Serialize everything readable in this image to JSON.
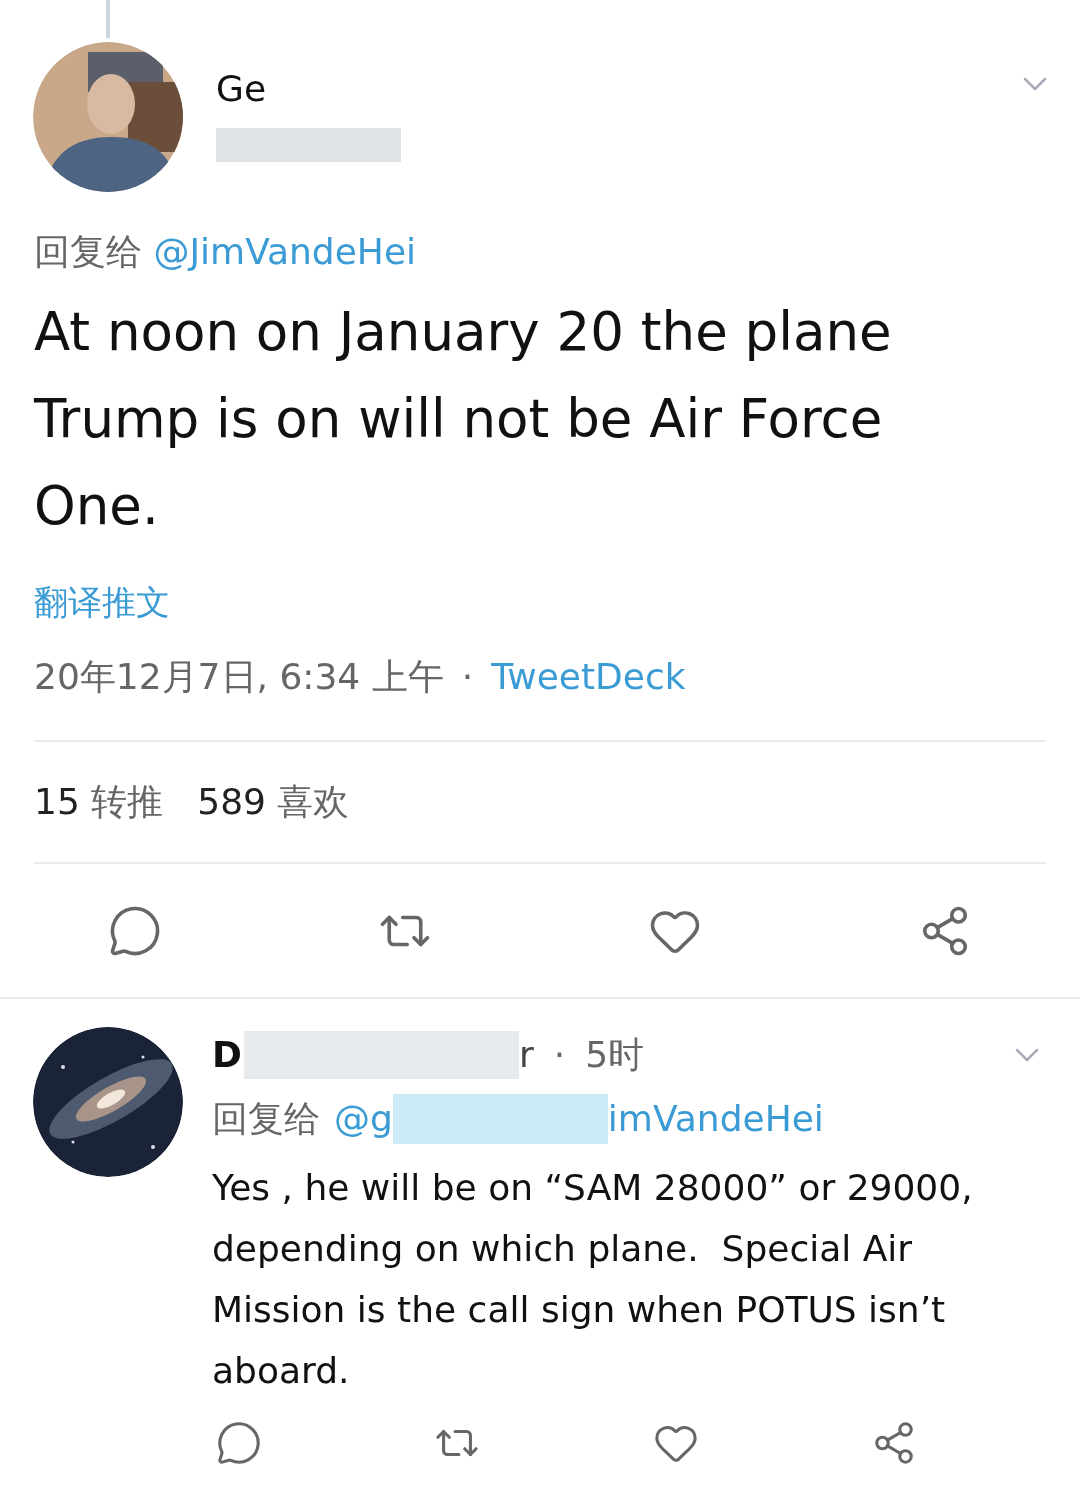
{
  "tweet": {
    "author_name": "Ge",
    "reply_prefix": "回复给",
    "reply_to": "@JimVandeHei",
    "text": "At noon on January 20 the plane Trump is on will not be Air Force One.",
    "translate": "翻译推文",
    "timestamp": "20年12月7日, 6:34 上午",
    "separator": "·",
    "source": "TweetDeck",
    "stats": [
      {
        "count": "15",
        "label": "转推"
      },
      {
        "count": "589",
        "label": "喜欢"
      }
    ],
    "actions": [
      {
        "kind": "reply"
      },
      {
        "kind": "retweet"
      },
      {
        "kind": "like"
      },
      {
        "kind": "share"
      }
    ]
  },
  "reply": {
    "author_name_start": "D",
    "author_name_end": "r",
    "separator": "·",
    "time": "5时",
    "reply_prefix": "回复给",
    "reply_to_start": "@g",
    "reply_to_end": "imVandeHei",
    "text": "Yes , he will be on “SAM 28000” or 29000, depending on which plane.  Special Air Mission is the call sign when POTUS isn’t aboard.",
    "actions": [
      {
        "kind": "reply"
      },
      {
        "kind": "retweet"
      },
      {
        "kind": "like"
      },
      {
        "kind": "share"
      }
    ]
  }
}
